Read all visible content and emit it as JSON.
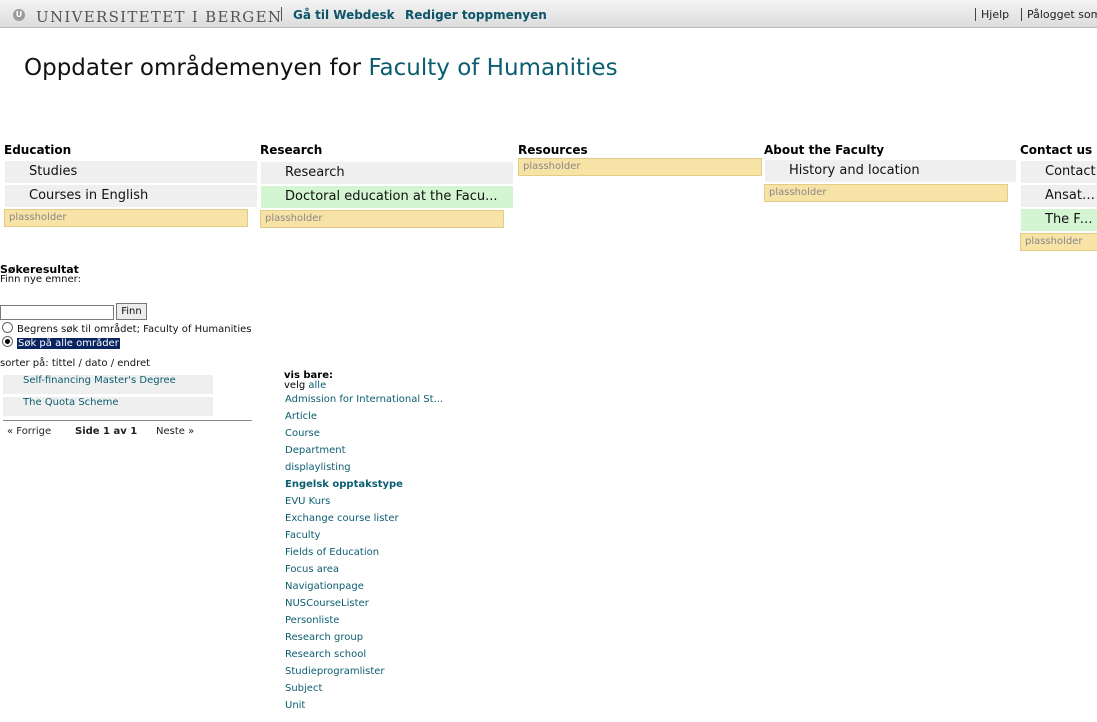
{
  "topbar": {
    "logo_text": "UNIVERSITETET I BERGEN",
    "logo_seal": "U",
    "links": [
      "Gå til Webdesk",
      "Rediger toppmenyen"
    ],
    "right": [
      "Hjelp",
      "Pålogget som"
    ]
  },
  "title": {
    "prefix": "Oppdater områdemenyen for",
    "faculty": "Faculty of Humanities"
  },
  "menu": {
    "placeholder": "plassholder",
    "columns": [
      {
        "heading": "Education",
        "items": [
          "Studies",
          "Courses in English"
        ]
      },
      {
        "heading": "Research",
        "items": [
          "Research",
          "Doctoral education at the Facu..."
        ]
      },
      {
        "heading": "Resources",
        "items": []
      },
      {
        "heading": "About the Faculty",
        "items": [
          "History and location"
        ]
      },
      {
        "heading": "Contact us",
        "items": [
          "Contact",
          "Ansattka",
          "The Facu"
        ]
      }
    ]
  },
  "search": {
    "heading": "Søkeresultat",
    "prompt": "Finn nye emner:",
    "input_value": "",
    "button": "Finn",
    "option_limit": "Begrens søk til området; Faculty of Humanities",
    "option_all": "Søk på alle områder",
    "sort_label": "sorter på: tittel / dato / endret"
  },
  "results": [
    "Self-financing Master's Degree",
    "The Quota Scheme"
  ],
  "pager": {
    "prev": "« Forrige",
    "page": "Side 1 av 1",
    "next": "Neste »"
  },
  "filter": {
    "heading": "vis bare:",
    "velg": "velg",
    "all": "alle",
    "types": [
      "Admission for International St...",
      "Article",
      "Course",
      "Department",
      "displaylisting",
      "Engelsk opptakstype",
      "EVU Kurs",
      "Exchange course lister",
      "Faculty",
      "Fields of Education",
      "Focus area",
      "Navigationpage",
      "NUSCourseLister",
      "Personliste",
      "Research group",
      "Research school",
      "Studieprogramlister",
      "Subject",
      "Unit"
    ]
  }
}
